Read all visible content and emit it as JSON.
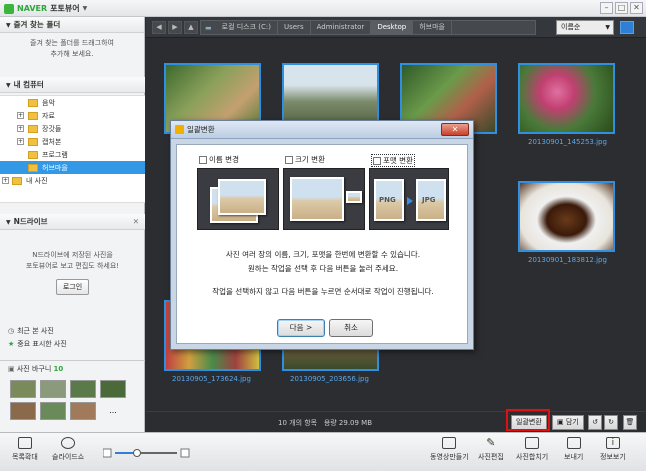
{
  "app": {
    "brand": "NAVER",
    "title": "포토뷰어"
  },
  "window": {
    "min": "–",
    "max": "□",
    "close": "✕"
  },
  "left": {
    "favorites_header": "즐겨 찾는 폴더",
    "favorites_hint_1": "즐겨 찾는 폴더를 드래그하여",
    "favorites_hint_2": "추가해 보세요.",
    "computer_header": "내 컴퓨터",
    "tree": [
      {
        "label": "음악",
        "expand": ""
      },
      {
        "label": "자료",
        "expand": "+"
      },
      {
        "label": "장갓들",
        "expand": "+"
      },
      {
        "label": "캡처본",
        "expand": "+"
      },
      {
        "label": "프로그램",
        "expand": ""
      },
      {
        "label": "허브마을",
        "expand": ""
      }
    ],
    "tree_partial": "내 사진",
    "ndrive_header": "N드라이브",
    "ndrive_hint_1": "N드라이브에 저장된 사진을",
    "ndrive_hint_2": "포토뷰어로 보고 편집도 하세요!",
    "login": "로그인",
    "recent": "최근 본 사진",
    "important": "중요 표시한 사진",
    "basket_label": "사진 바구니",
    "basket_count": "10",
    "more": "..."
  },
  "path": {
    "crumbs": [
      "로컬 디스크 (C:)",
      "Users",
      "Administrator",
      "Desktop",
      "허브마을"
    ],
    "sort": "이름순"
  },
  "grid": {
    "captions": [
      "20130901_145253.jpg",
      "20130901_183812.jpg",
      "20130905_173624.jpg",
      "20130905_203656.jpg"
    ]
  },
  "status": {
    "count": "10 개의 항목",
    "size": "용량 29.09 MB",
    "batch": "일괄변환",
    "hide": "담기"
  },
  "toolbar": {
    "full": "목록확대",
    "slideshow": "슬라이드쇼",
    "video": "동영상만들기",
    "edit": "사진편집",
    "merge": "사진합치기",
    "send": "보내기",
    "info": "정보보기"
  },
  "dialog": {
    "title": "일괄변환",
    "opt_name": "이름 변경",
    "opt_size": "크기 변환",
    "opt_format": "포맷 변환",
    "fmt_from": "PNG",
    "fmt_to": "JPG",
    "desc1": "사진 여러 장의 이름, 크기, 포맷을 한번에 변환할 수 있습니다.",
    "desc2": "원하는 작업을 선택 후 다음 버튼을 눌러 주세요.",
    "desc3": "작업을 선택하지 않고 다음 버튼을 누르면 순서대로 작업이 진행됩니다.",
    "next": "다음 >",
    "cancel": "취소"
  }
}
